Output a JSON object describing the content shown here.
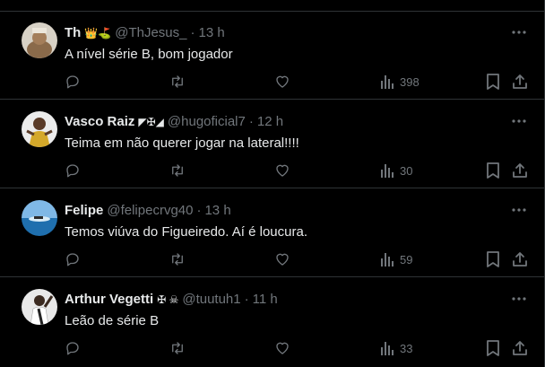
{
  "colors": {
    "background": "#000000",
    "divider": "#2f3336",
    "text_primary": "#e7e9ea",
    "text_secondary": "#71767b"
  },
  "tweets": [
    {
      "name": "Th",
      "name_decor": "👑⛳",
      "handle": "@ThJesus_",
      "separator": "·",
      "time": "13 h",
      "text": "A nível série B, bom jogador",
      "views": "398",
      "avatar_icon": "avatar-photo"
    },
    {
      "name": "Vasco Raiz",
      "name_decor": "◤✠◢",
      "handle": "@hugoficial7",
      "separator": "·",
      "time": "12 h",
      "text": "Teima em não querer jogar na lateral!!!!",
      "views": "30",
      "avatar_icon": "avatar-photo"
    },
    {
      "name": "Felipe",
      "name_decor": "",
      "handle": "@felipecrvg40",
      "separator": "·",
      "time": "13 h",
      "text": "Temos viúva do Figueiredo. Aí é loucura.",
      "views": "59",
      "avatar_icon": "avatar-photo"
    },
    {
      "name": "Arthur Vegetti",
      "name_decor": "✠ ☠",
      "handle": "@tuutuh1",
      "separator": "·",
      "time": "11 h",
      "text": "Leão de série B",
      "views": "33",
      "avatar_icon": "avatar-photo"
    }
  ],
  "icons": {
    "reply": "reply-icon",
    "retweet": "retweet-icon",
    "like": "like-icon",
    "views": "views-icon",
    "bookmark": "bookmark-icon",
    "share": "share-icon",
    "more": "more-icon"
  }
}
